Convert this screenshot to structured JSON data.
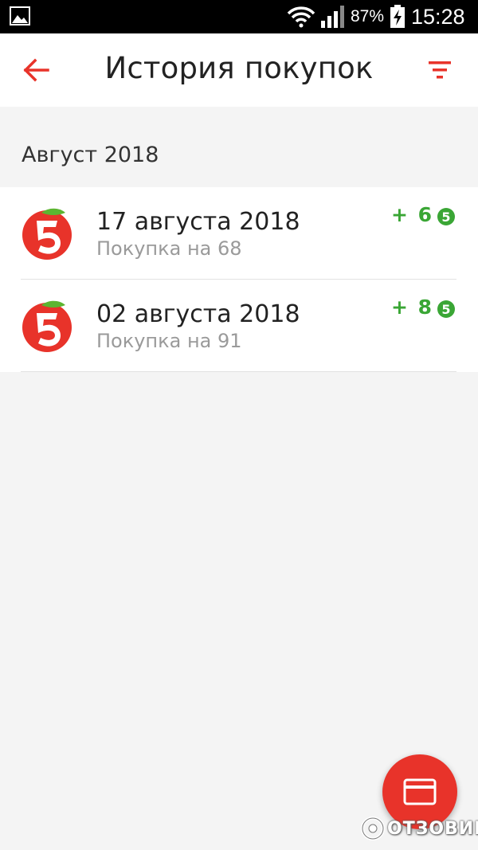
{
  "status_bar": {
    "battery_percent": "87%",
    "time": "15:28",
    "icons": [
      "gallery-icon",
      "wifi-icon",
      "signal-icon",
      "battery-charging-icon"
    ]
  },
  "app_bar": {
    "title": "История покупок",
    "back_icon": "arrow-left-icon",
    "filter_icon": "filter-icon"
  },
  "section": {
    "title": "Август 2018"
  },
  "purchases": [
    {
      "date": "17 августа 2018",
      "subtitle": "Покупка на 68",
      "points": "+ 6",
      "points_badge": "5"
    },
    {
      "date": "02 августа 2018",
      "subtitle": "Покупка на 91",
      "points": "+ 8",
      "points_badge": "5"
    }
  ],
  "fab": {
    "icon": "card-icon"
  },
  "watermark": {
    "text": "ОТЗОВИК"
  },
  "colors": {
    "accent_red": "#e8332a",
    "points_green": "#3aa635",
    "background": "#f4f4f4"
  }
}
